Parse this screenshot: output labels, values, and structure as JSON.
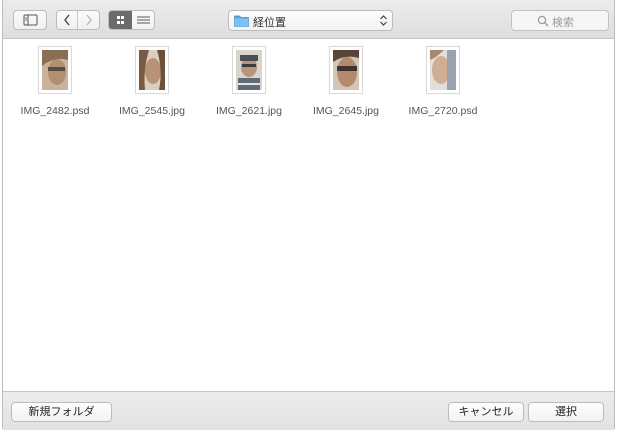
{
  "toolbar": {
    "location": "経位置",
    "search_placeholder": "検索",
    "sidebar_icon": "sidebar-toggle-icon",
    "back_icon": "chevron-left-icon",
    "forward_icon": "chevron-right-icon",
    "icon_view_icon": "grid-icon",
    "list_view_icon": "list-icon"
  },
  "files": [
    {
      "name": "IMG_2482.psd"
    },
    {
      "name": "IMG_2545.jpg"
    },
    {
      "name": "IMG_2621.jpg"
    },
    {
      "name": "IMG_2645.jpg"
    },
    {
      "name": "IMG_2720.psd"
    }
  ],
  "footer": {
    "new_folder": "新規フォルダ",
    "cancel": "キャンセル",
    "select": "選択"
  },
  "colors": {
    "folder": "#5aa9e6",
    "toolbar_bg": "#e4e4e4",
    "selected_segment": "#6b6b6b"
  }
}
